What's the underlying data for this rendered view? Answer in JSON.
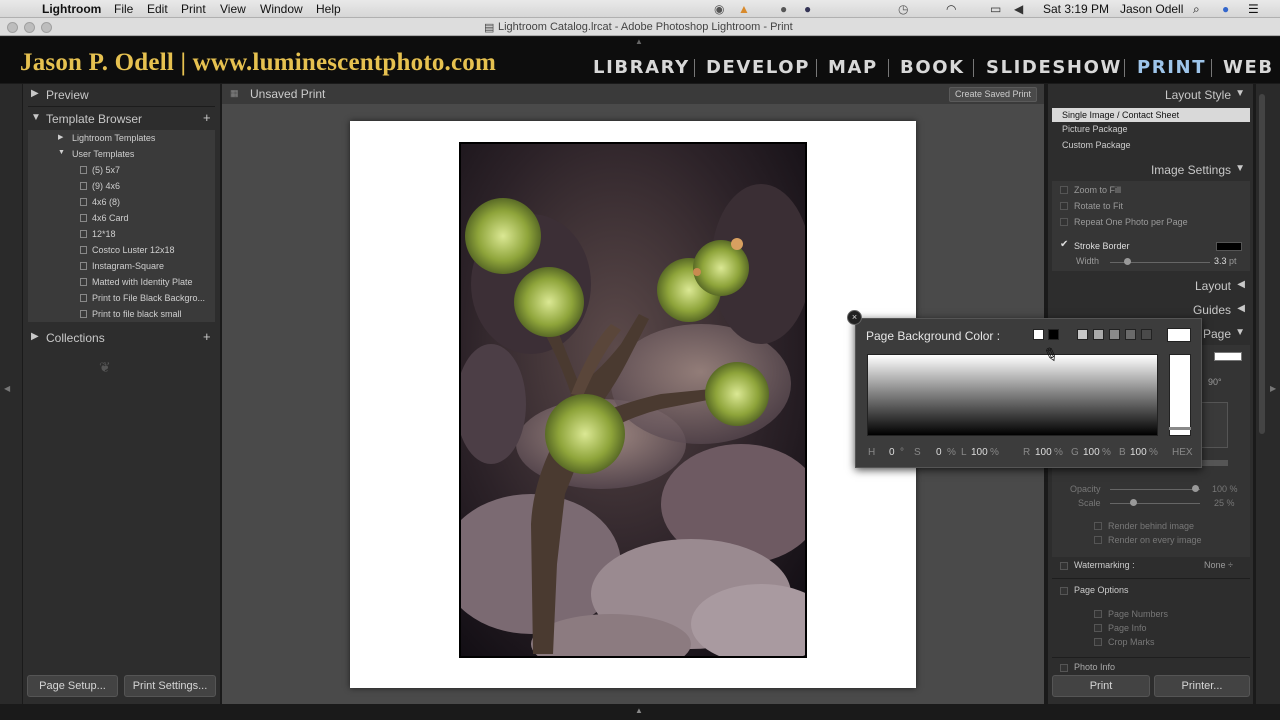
{
  "menubar": {
    "app": "Lightroom",
    "items": [
      "File",
      "Edit",
      "Print",
      "View",
      "Window",
      "Help"
    ],
    "clock": "Sat 3:19 PM",
    "user": "Jason Odell"
  },
  "window": {
    "title": "Lightroom Catalog.lrcat - Adobe Photoshop Lightroom - Print"
  },
  "identity_plate": "Jason P. Odell | www.luminescentphoto.com",
  "modules": [
    "LIBRARY",
    "DEVELOP",
    "MAP",
    "BOOK",
    "SLIDESHOW",
    "PRINT",
    "WEB"
  ],
  "active_module": "PRINT",
  "left_panel": {
    "preview": "Preview",
    "template_browser": "Template Browser",
    "lightroom_templates": "Lightroom Templates",
    "user_templates": "User Templates",
    "templates": [
      "(5) 5x7",
      "(9) 4x6",
      "4x6 (8)",
      "4x6 Card",
      "12*18",
      "Costco Luster 12x18",
      "Instagram-Square",
      "Matted with Identity Plate",
      "Print to File Black Backgro...",
      "Print to file black small"
    ],
    "collections": "Collections",
    "page_setup": "Page Setup...",
    "print_settings": "Print Settings..."
  },
  "toolbar": {
    "title": "Unsaved Print",
    "create_saved_print": "Create Saved Print"
  },
  "right_panel": {
    "layout_style": "Layout Style",
    "layout_options": [
      "Single Image / Contact Sheet",
      "Picture Package",
      "Custom Package"
    ],
    "image_settings": "Image Settings",
    "zoom_to_fill": "Zoom to Fill",
    "rotate_to_fit": "Rotate to Fit",
    "repeat_one": "Repeat One Photo per Page",
    "stroke_border": "Stroke Border",
    "width_label": "Width",
    "width_value": "3.3",
    "width_unit": "pt",
    "layout": "Layout",
    "guides": "Guides",
    "page": "Page",
    "rotation": "90°",
    "opacity": "Opacity",
    "opacity_value": "100 %",
    "scale": "Scale",
    "scale_value": "25 %",
    "render_behind": "Render behind image",
    "render_every": "Render on every image",
    "watermarking": "Watermarking :",
    "watermark_value": "None ÷",
    "page_options": "Page Options",
    "page_numbers": "Page Numbers",
    "page_info": "Page Info",
    "crop_marks": "Crop Marks",
    "photo_info": "Photo Info",
    "print": "Print",
    "printer": "Printer..."
  },
  "color_popup": {
    "title": "Page Background Color :",
    "h_label": "H",
    "h_value": "0",
    "h_unit": "°",
    "s_label": "S",
    "s_value": "0",
    "s_unit": "%",
    "l_label": "L",
    "l_value": "100",
    "l_unit": "%",
    "r_label": "R",
    "r_value": "100",
    "r_unit": "%",
    "g_label": "G",
    "g_value": "100",
    "g_unit": "%",
    "b_label": "B",
    "b_value": "100",
    "b_unit": "%",
    "hex": "HEX"
  },
  "colors": {
    "accent": "#9ec5ea",
    "identity_text": "#e6c150",
    "panel_bg": "#2d2d2d"
  }
}
